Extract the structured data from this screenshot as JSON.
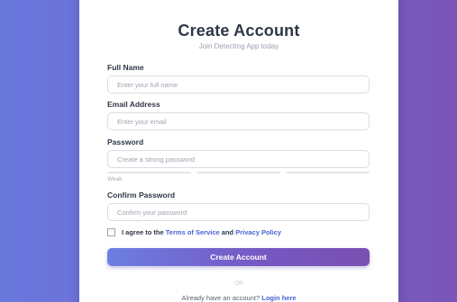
{
  "header": {
    "title": "Create Account",
    "subtitle": "Join Detecting App today"
  },
  "form": {
    "full_name": {
      "label": "Full Name",
      "placeholder": "Enter your full name",
      "value": ""
    },
    "email": {
      "label": "Email Address",
      "placeholder": "Enter your email",
      "value": ""
    },
    "password": {
      "label": "Password",
      "placeholder": "Create a strong password",
      "value": "",
      "strength_label": "Weak"
    },
    "confirm_password": {
      "label": "Confirm Password",
      "placeholder": "Confirm your password",
      "value": ""
    },
    "terms": {
      "checked": false,
      "text_before": "I agree to the",
      "terms_link": "Terms of Service",
      "text_and": "and",
      "privacy_link": "Privacy Policy"
    },
    "submit_label": "Create Account"
  },
  "divider_text": "OR",
  "footer": {
    "prompt": "Already have an account?",
    "login_link": "Login here"
  },
  "colors": {
    "background_start": "#6a78dd",
    "background_end": "#7a55b8",
    "link": "#4b63d6",
    "button_start": "#6c7ee1",
    "button_end": "#7a4fb1"
  }
}
